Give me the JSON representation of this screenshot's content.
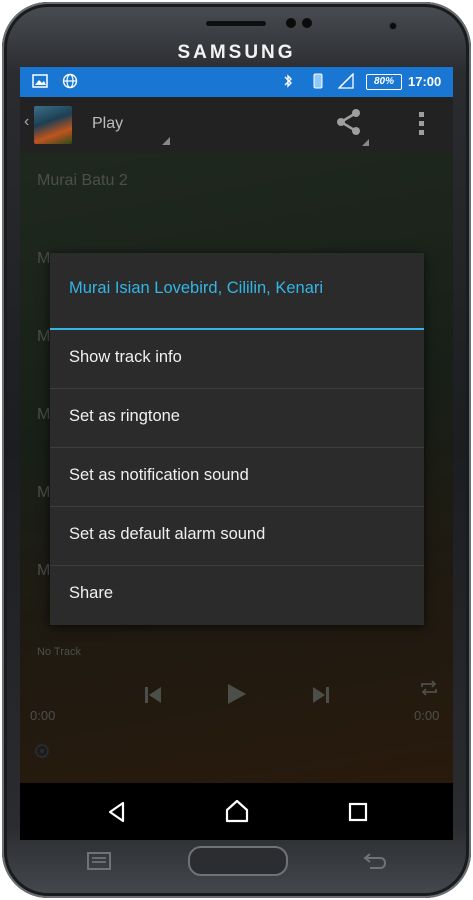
{
  "device": {
    "brand": "SAMSUNG"
  },
  "status_bar": {
    "time": "17:00",
    "battery_percent": "80%",
    "icons": [
      "image-notification-icon",
      "globe-icon",
      "bluetooth-icon",
      "phone-vibrate-icon",
      "signal-icon",
      "battery-icon"
    ]
  },
  "action_bar": {
    "title": "Play",
    "icons": [
      "back-icon",
      "album-art",
      "share-icon",
      "overflow-menu-icon"
    ]
  },
  "background_list": {
    "items": [
      "Murai Batu 2",
      "M",
      "M",
      "M",
      "M",
      "M"
    ],
    "now_playing": "No Track",
    "elapsed": "0:00",
    "duration": "0:00"
  },
  "dialog": {
    "title": "Murai Isian Lovebird, Cililin, Kenari",
    "items": [
      "Show track info",
      "Set as ringtone",
      "Set as notification sound",
      "Set as default alarm sound",
      "Share"
    ],
    "accent_color": "#33b5e5"
  },
  "nav_bar": {
    "icons": [
      "back-nav-icon",
      "home-nav-icon",
      "recents-nav-icon"
    ]
  },
  "colors": {
    "status_bar": "#1976d2",
    "dialog_bg": "#2b2b2b",
    "accent": "#33b5e5"
  }
}
